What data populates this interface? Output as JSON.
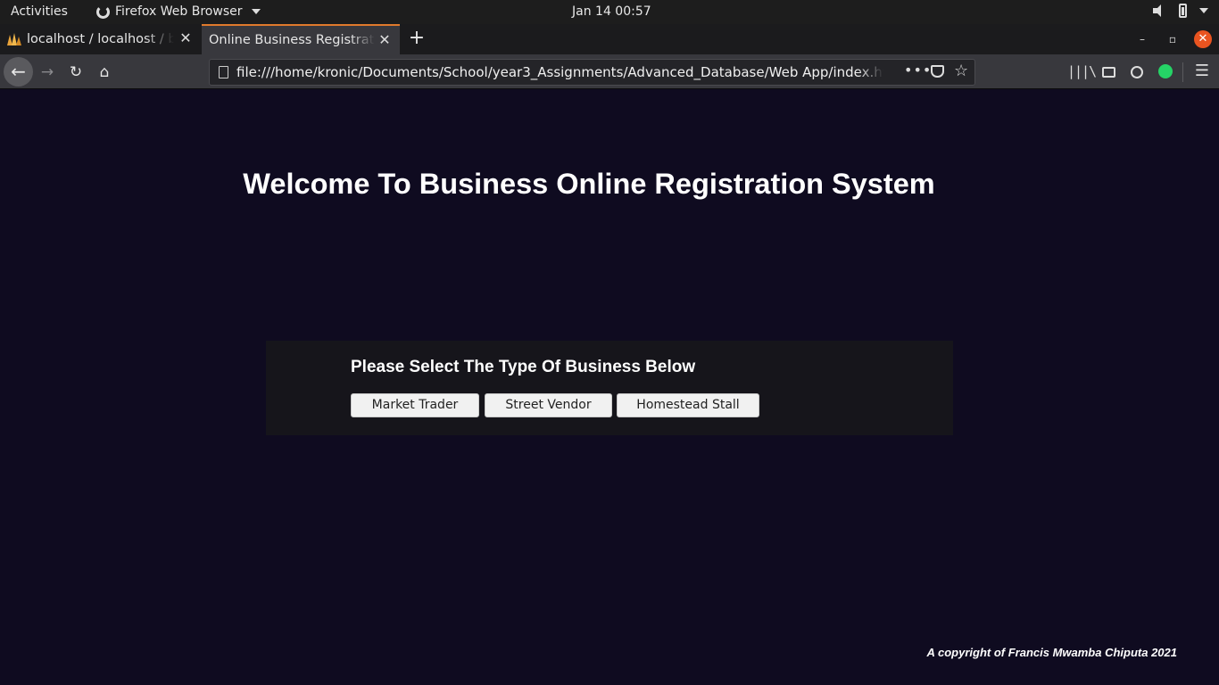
{
  "system_bar": {
    "activities": "Activities",
    "app_name": "Firefox Web Browser",
    "clock": "Jan 14  00:57"
  },
  "browser": {
    "tabs": [
      {
        "title": "localhost / localhost / bu",
        "active": false
      },
      {
        "title": "Online Business Registration",
        "active": true
      }
    ],
    "url": "file:///home/kronic/Documents/School/year3_Assignments/Advanced_Database/Web App/index.html?Ma",
    "accent_color": "#e07a2c"
  },
  "page": {
    "title": "Welcome To Business Online Registration System",
    "panel_heading": "Please Select The Type Of Business Below",
    "buttons": {
      "market_trader": "Market Trader",
      "street_vendor": "Street Vendor",
      "homestead_stall": "Homestead Stall"
    },
    "copyright": "A copyright of Francis Mwamba Chiputa 2021",
    "background_color": "#0f0b20",
    "panel_color": "#16151b"
  }
}
